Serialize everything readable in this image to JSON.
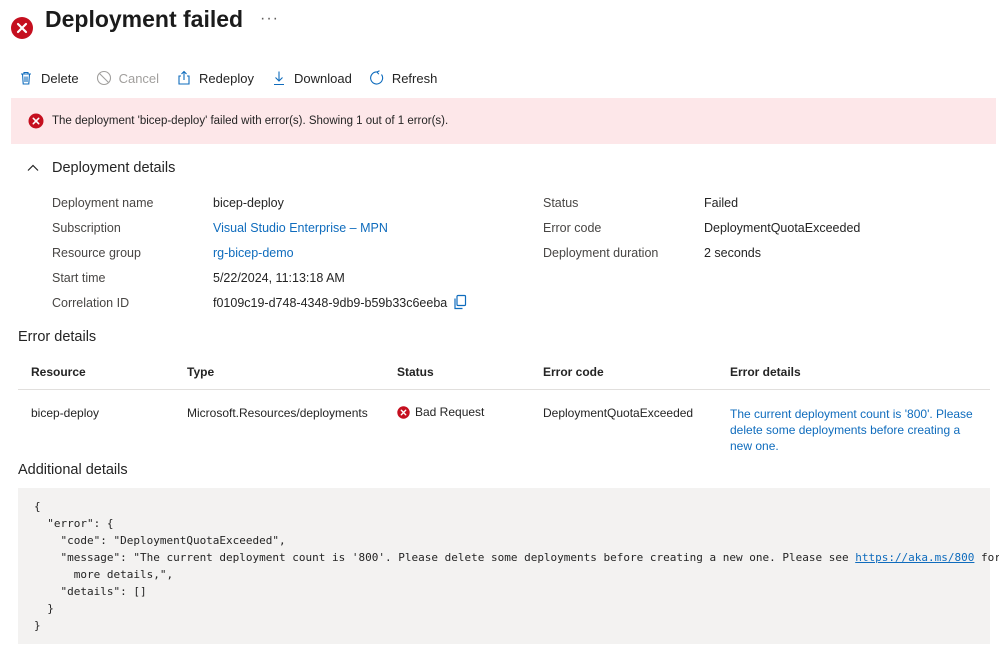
{
  "page": {
    "title": "Deployment failed",
    "more_label": "···"
  },
  "toolbar": {
    "delete_label": "Delete",
    "cancel_label": "Cancel",
    "redeploy_label": "Redeploy",
    "download_label": "Download",
    "refresh_label": "Refresh"
  },
  "banner": {
    "text": "The deployment 'bicep-deploy' failed with error(s). Showing 1 out of 1 error(s)."
  },
  "deployment_details": {
    "title": "Deployment details",
    "left": [
      {
        "label": "Deployment name",
        "value": "bicep-deploy"
      },
      {
        "label": "Subscription",
        "value": "Visual Studio Enterprise – MPN"
      },
      {
        "label": "Resource group",
        "value": "rg-bicep-demo"
      },
      {
        "label": "Start time",
        "value": "5/22/2024, 11:13:18 AM"
      },
      {
        "label": "Correlation ID",
        "value": "f0109c19-d748-4348-9db9-b59b33c6eeba"
      }
    ],
    "right": [
      {
        "label": "Status",
        "value": "Failed"
      },
      {
        "label": "Error code",
        "value": "DeploymentQuotaExceeded"
      },
      {
        "label": "Deployment duration",
        "value": "2 seconds"
      }
    ]
  },
  "error_details": {
    "title": "Error details",
    "columns": [
      "Resource",
      "Type",
      "Status",
      "Error code",
      "Error details"
    ],
    "rows": [
      {
        "resource": "bicep-deploy",
        "type": "Microsoft.Resources/deployments",
        "status": "Bad Request",
        "error_code": "DeploymentQuotaExceeded",
        "details": "The current deployment count is '800'. Please delete some deployments before creating a new one."
      }
    ]
  },
  "additional_details": {
    "title": "Additional details",
    "line1": "{",
    "line2": "  \"error\": {",
    "line3": "    \"code\": \"DeploymentQuotaExceeded\",",
    "line4_pre": "    \"message\": \"The current deployment count is '800'. Please delete some deployments before creating a new one. Please see ",
    "line4_url": "https://aka.ms/800",
    "line4_post": " for",
    "line5": "      more details,\",",
    "line6": "    \"details\": []",
    "line7": "  }",
    "line8": "}"
  },
  "colors": {
    "error_red": "#c50f1f",
    "link_blue": "#0f6cbd",
    "banner_bg": "#fde7e9",
    "code_bg": "#f3f2f1"
  },
  "icons": {
    "title": "error-circle-icon",
    "delete": "trash-icon",
    "cancel": "cancel-circle-icon",
    "redeploy": "share-upload-icon",
    "download": "download-arrow-icon",
    "refresh": "refresh-icon",
    "collapse": "chevron-up-icon",
    "copy": "copy-icon"
  }
}
